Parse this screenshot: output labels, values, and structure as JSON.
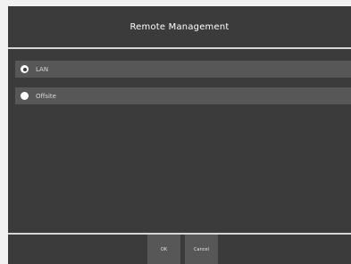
{
  "dialog": {
    "title": "Remote Management",
    "options": [
      {
        "label": "LAN",
        "selected": true
      },
      {
        "label": "Offsite",
        "selected": false
      }
    ],
    "buttons": {
      "ok_label": "OK",
      "cancel_label": "Cancel"
    }
  },
  "colors": {
    "background": "#3b3b3b",
    "row": "#575757",
    "divider": "#d6d6d6",
    "text": "#ffffff"
  }
}
